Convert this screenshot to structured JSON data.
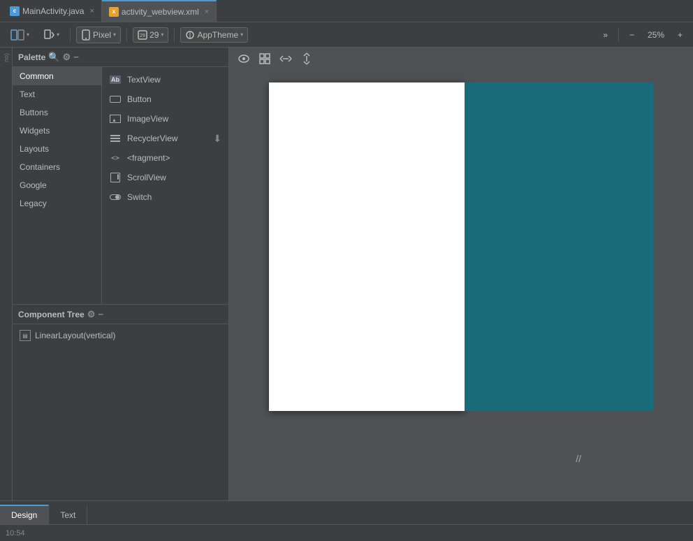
{
  "tabs": [
    {
      "id": "main-activity",
      "label": "MainActivity.java",
      "type": "java",
      "icon_text": "c",
      "active": false
    },
    {
      "id": "activity-webview",
      "label": "activity_webview.xml",
      "type": "xml",
      "icon_text": "x",
      "active": true
    }
  ],
  "toolbar": {
    "view_toggle_label": "▾",
    "api_dropdown": "29",
    "theme_dropdown": "AppTheme",
    "zoom_label": "25%",
    "zoom_in": "+",
    "zoom_out": "−",
    "more_label": "»",
    "pixel_dropdown": "Pixel"
  },
  "palette": {
    "title": "Palette",
    "search_placeholder": "Search",
    "categories": [
      {
        "id": "common",
        "label": "Common",
        "active": true
      },
      {
        "id": "text",
        "label": "Text"
      },
      {
        "id": "buttons",
        "label": "Buttons"
      },
      {
        "id": "widgets",
        "label": "Widgets"
      },
      {
        "id": "layouts",
        "label": "Layouts"
      },
      {
        "id": "containers",
        "label": "Containers"
      },
      {
        "id": "google",
        "label": "Google"
      },
      {
        "id": "legacy",
        "label": "Legacy"
      }
    ],
    "items": [
      {
        "id": "textview",
        "label": "TextView",
        "icon_type": "ab",
        "downloadable": false
      },
      {
        "id": "button",
        "label": "Button",
        "icon_type": "button-rect",
        "downloadable": false
      },
      {
        "id": "imageview",
        "label": "ImageView",
        "icon_type": "image",
        "downloadable": false
      },
      {
        "id": "recyclerview",
        "label": "RecyclerView",
        "icon_type": "list",
        "downloadable": true
      },
      {
        "id": "fragment",
        "label": "<fragment>",
        "icon_type": "fragment",
        "downloadable": false
      },
      {
        "id": "scrollview",
        "label": "ScrollView",
        "icon_type": "scroll",
        "downloadable": false
      },
      {
        "id": "switch",
        "label": "Switch",
        "icon_type": "switch-icon",
        "downloadable": false
      }
    ]
  },
  "component_tree": {
    "title": "Component Tree",
    "items": [
      {
        "id": "linearlayout",
        "label": "LinearLayout(vertical)",
        "indent": 0
      }
    ]
  },
  "canvas": {
    "toolbar_buttons": [
      "eye",
      "grid",
      "expand-horizontal",
      "expand-vertical"
    ]
  },
  "bottom_tabs": [
    {
      "id": "design",
      "label": "Design",
      "active": true
    },
    {
      "id": "text",
      "label": "Text",
      "active": false
    }
  ],
  "status_bar": {
    "time": "10:54"
  },
  "left_edge": {
    "label": "no)"
  }
}
